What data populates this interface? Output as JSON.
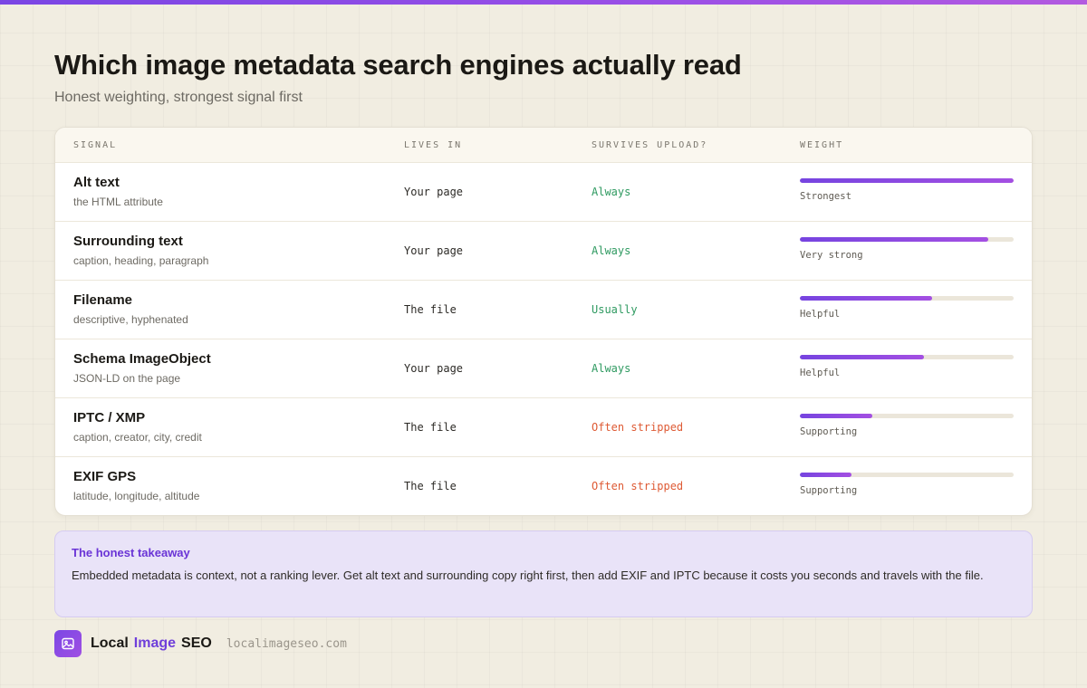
{
  "header": {
    "title": "Which image metadata search engines actually read",
    "subtitle": "Honest weighting, strongest signal first"
  },
  "colors": {
    "accent": "#7a46e4",
    "always": "#2f9a61",
    "stripped": "#de5a34",
    "background": "#f1ede1"
  },
  "table": {
    "columns": [
      "SIGNAL",
      "LIVES IN",
      "SURVIVES UPLOAD?",
      "WEIGHT"
    ],
    "rows": [
      {
        "name": "Alt text",
        "desc": "the HTML attribute",
        "lives_in": "Your page",
        "survives": "Always",
        "survives_status": "good",
        "weight_label": "Strongest",
        "weight": 1.0
      },
      {
        "name": "Surrounding text",
        "desc": "caption, heading, paragraph",
        "lives_in": "Your page",
        "survives": "Always",
        "survives_status": "good",
        "weight_label": "Very strong",
        "weight": 0.88
      },
      {
        "name": "Filename",
        "desc": "descriptive, hyphenated",
        "lives_in": "The file",
        "survives": "Usually",
        "survives_status": "good",
        "weight_label": "Helpful",
        "weight": 0.62
      },
      {
        "name": "Schema ImageObject",
        "desc": "JSON-LD on the page",
        "lives_in": "Your page",
        "survives": "Always",
        "survives_status": "good",
        "weight_label": "Helpful",
        "weight": 0.58
      },
      {
        "name": "IPTC / XMP",
        "desc": "caption, creator, city, credit",
        "lives_in": "The file",
        "survives": "Often stripped",
        "survives_status": "bad",
        "weight_label": "Supporting",
        "weight": 0.34
      },
      {
        "name": "EXIF GPS",
        "desc": "latitude, longitude, altitude",
        "lives_in": "The file",
        "survives": "Often stripped",
        "survives_status": "bad",
        "weight_label": "Supporting",
        "weight": 0.24
      }
    ]
  },
  "takeaway": {
    "title": "The honest takeaway",
    "text": "Embedded metadata is context, not a ranking lever. Get alt text and surrounding copy right first, then add EXIF and IPTC because it costs you seconds and travels with the file."
  },
  "footer": {
    "logo_icon": "image-icon",
    "brand_local": "Local",
    "brand_image": "Image",
    "brand_seo": "SEO",
    "url": "localimageseo.com"
  }
}
